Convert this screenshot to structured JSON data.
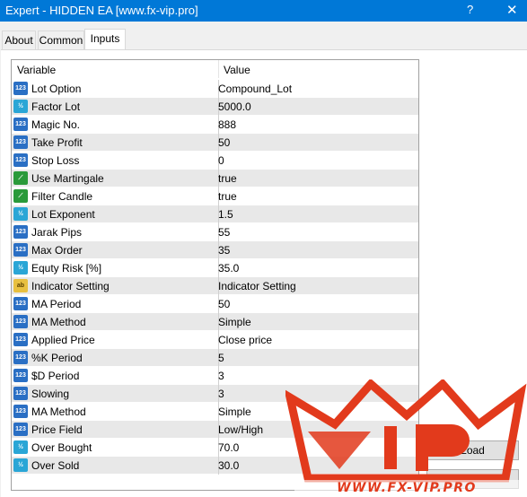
{
  "window": {
    "title": "Expert - HIDDEN EA [www.fx-vip.pro]",
    "help": "?",
    "close": "✕"
  },
  "tabs": [
    {
      "label": "About"
    },
    {
      "label": "Common"
    },
    {
      "label": "Inputs"
    }
  ],
  "table": {
    "headers": {
      "variable": "Variable",
      "value": "Value"
    },
    "rows": [
      {
        "type": "int",
        "icon": "123",
        "name": "Lot Option",
        "value": "Compound_Lot"
      },
      {
        "type": "dbl",
        "icon": "½",
        "name": "Factor Lot",
        "value": "5000.0"
      },
      {
        "type": "int",
        "icon": "123",
        "name": "Magic No.",
        "value": "888"
      },
      {
        "type": "int",
        "icon": "123",
        "name": "Take Profit",
        "value": "50"
      },
      {
        "type": "int",
        "icon": "123",
        "name": "Stop Loss",
        "value": "0"
      },
      {
        "type": "bool",
        "icon": "⟋",
        "name": "Use Martingale",
        "value": "true"
      },
      {
        "type": "bool",
        "icon": "⟋",
        "name": "Filter Candle",
        "value": "true"
      },
      {
        "type": "dbl",
        "icon": "½",
        "name": "Lot Exponent",
        "value": "1.5"
      },
      {
        "type": "int",
        "icon": "123",
        "name": "Jarak Pips",
        "value": "55"
      },
      {
        "type": "int",
        "icon": "123",
        "name": "Max Order",
        "value": "35"
      },
      {
        "type": "dbl",
        "icon": "½",
        "name": "Equty Risk [%]",
        "value": "35.0"
      },
      {
        "type": "str",
        "icon": "ab",
        "name": "Indicator Setting",
        "value": "Indicator Setting"
      },
      {
        "type": "int",
        "icon": "123",
        "name": "MA Period",
        "value": "50"
      },
      {
        "type": "int",
        "icon": "123",
        "name": "MA Method",
        "value": "Simple"
      },
      {
        "type": "int",
        "icon": "123",
        "name": "Applied Price",
        "value": "Close price"
      },
      {
        "type": "int",
        "icon": "123",
        "name": "%K Period",
        "value": "5"
      },
      {
        "type": "int",
        "icon": "123",
        "name": "$D Period",
        "value": "3"
      },
      {
        "type": "int",
        "icon": "123",
        "name": "Slowing",
        "value": "3"
      },
      {
        "type": "int",
        "icon": "123",
        "name": "MA Method",
        "value": "Simple"
      },
      {
        "type": "int",
        "icon": "123",
        "name": "Price Field",
        "value": "Low/High"
      },
      {
        "type": "dbl",
        "icon": "½",
        "name": "Over Bought",
        "value": "70.0"
      },
      {
        "type": "dbl",
        "icon": "½",
        "name": "Over Sold",
        "value": "30.0"
      }
    ]
  },
  "buttons": {
    "load": "Load",
    "save": ""
  },
  "watermark": {
    "text": "WWW.FX-VIP.PRO",
    "logo_letters": "VIP",
    "colors": {
      "primary": "#e23a1c"
    }
  }
}
